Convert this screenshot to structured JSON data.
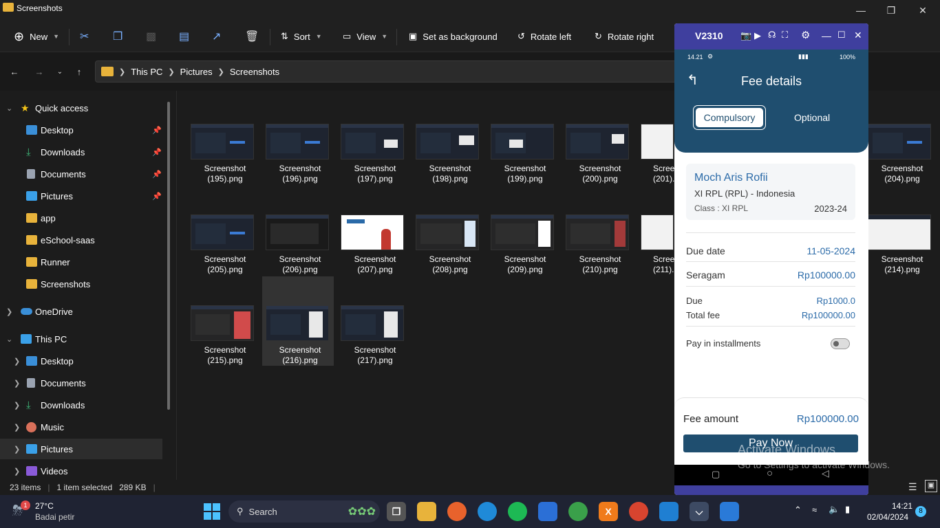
{
  "window": {
    "title": "Screenshots"
  },
  "toolbar": {
    "new_label": "New",
    "sort_label": "Sort",
    "view_label": "View",
    "set_background_label": "Set as background",
    "rotate_left_label": "Rotate left",
    "rotate_right_label": "Rotate right"
  },
  "breadcrumb": [
    "This PC",
    "Pictures",
    "Screenshots"
  ],
  "sidebar": {
    "quick_access": "Quick access",
    "items": [
      {
        "label": "Desktop",
        "icon": "desktop-icon",
        "pinned": true
      },
      {
        "label": "Downloads",
        "icon": "download-icon",
        "pinned": true
      },
      {
        "label": "Documents",
        "icon": "document-icon",
        "pinned": true
      },
      {
        "label": "Pictures",
        "icon": "pictures-icon",
        "pinned": true
      },
      {
        "label": "app",
        "icon": "folder-icon"
      },
      {
        "label": "eSchool-saas",
        "icon": "folder-icon"
      },
      {
        "label": "Runner",
        "icon": "folder-icon"
      },
      {
        "label": "Screenshots",
        "icon": "folder-icon"
      }
    ],
    "onedrive": "OneDrive",
    "this_pc": "This PC",
    "pc_items": [
      {
        "label": "Desktop",
        "icon": "desktop-icon"
      },
      {
        "label": "Documents",
        "icon": "document-icon"
      },
      {
        "label": "Downloads",
        "icon": "download-icon"
      },
      {
        "label": "Music",
        "icon": "music-icon"
      },
      {
        "label": "Pictures",
        "icon": "pictures-icon"
      },
      {
        "label": "Videos",
        "icon": "videos-icon"
      }
    ]
  },
  "files": [
    {
      "line1": "Screenshot",
      "line2": "(195).png"
    },
    {
      "line1": "Screenshot",
      "line2": "(196).png"
    },
    {
      "line1": "Screenshot",
      "line2": "(197).png"
    },
    {
      "line1": "Screenshot",
      "line2": "(198).png"
    },
    {
      "line1": "Screenshot",
      "line2": "(199).png"
    },
    {
      "line1": "Screenshot",
      "line2": "(200).png"
    },
    {
      "line1": "Screen",
      "line2": "(201)."
    },
    {
      "line1": "Screenshot",
      "line2": "(204).png"
    },
    {
      "line1": "Screenshot",
      "line2": "(205).png"
    },
    {
      "line1": "Screenshot",
      "line2": "(206).png"
    },
    {
      "line1": "Screenshot",
      "line2": "(207).png"
    },
    {
      "line1": "Screenshot",
      "line2": "(208).png"
    },
    {
      "line1": "Screenshot",
      "line2": "(209).png"
    },
    {
      "line1": "Screenshot",
      "line2": "(210).png"
    },
    {
      "line1": "Screen",
      "line2": "(211)."
    },
    {
      "line1": "Screenshot",
      "line2": "(214).png"
    },
    {
      "line1": "Screenshot",
      "line2": "(215).png"
    },
    {
      "line1": "Screenshot",
      "line2": "(216).png"
    },
    {
      "line1": "Screenshot",
      "line2": "(217).png"
    }
  ],
  "status": {
    "items": "23 items",
    "selected": "1 item selected",
    "size": "289 KB"
  },
  "phone": {
    "device": "V2310",
    "time": "14.21",
    "battery": "100%",
    "header_title": "Fee details",
    "tab_compulsory": "Compulsory",
    "tab_optional": "Optional",
    "student_name": "Moch Aris Rofii",
    "student_class_line": "XI RPL (RPL)  - Indonesia",
    "class_label": "Class : XI RPL",
    "year": "2023-24",
    "due_date_label": "Due date",
    "due_date_value": "11-05-2024",
    "seragam_label": "Seragam",
    "seragam_value": "Rp100000.00",
    "due_label": "Due",
    "due_value": "Rp1000.0",
    "total_label": "Total fee",
    "total_value": "Rp100000.00",
    "installments_label": "Pay in installments",
    "fee_amount_label": "Fee amount",
    "fee_amount_value": "Rp100000.00",
    "pay_now": "Pay Now"
  },
  "watermark": {
    "line1": "Activate Windows",
    "line2": "Go to Settings to activate Windows."
  },
  "taskbar": {
    "weather_temp": "27°C",
    "weather_desc": "Badai petir",
    "weather_badge": "1",
    "search_label": "Search",
    "time": "14:21",
    "date": "02/04/2024",
    "notifications": "8"
  }
}
